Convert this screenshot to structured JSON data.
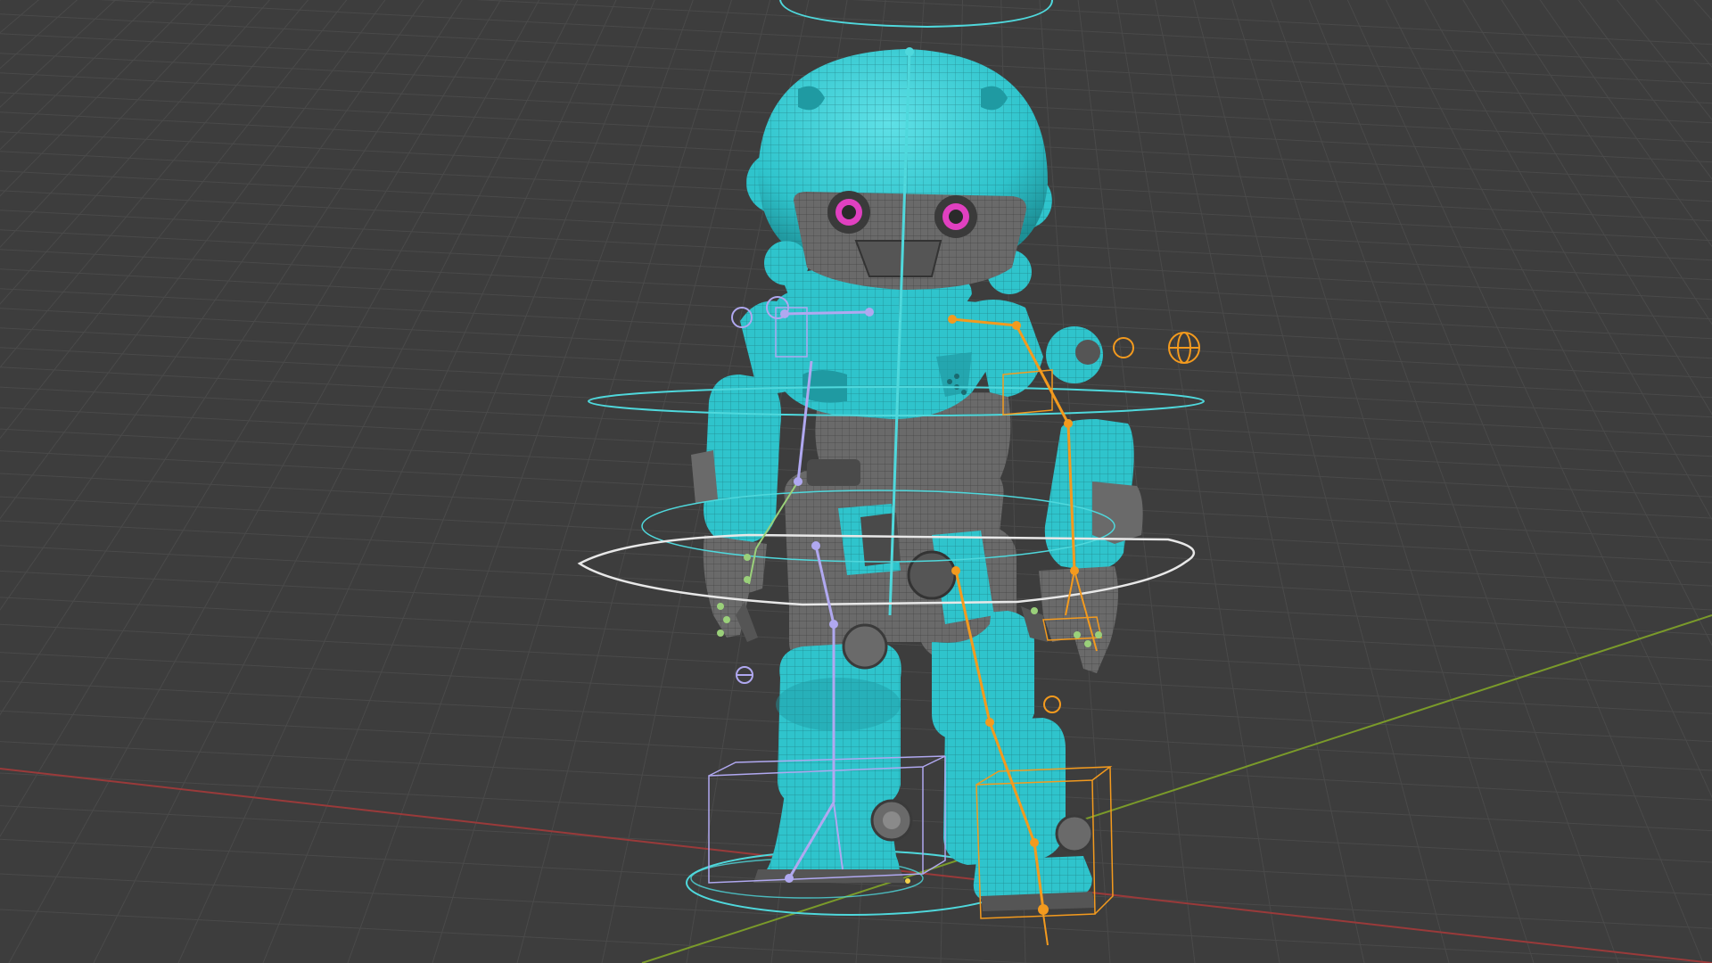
{
  "viewport": {
    "background": "#3d3d3d",
    "grid_color": "#4a4a4a",
    "x_axis_color": "#9a3a3a",
    "y_axis_color": "#7a9a2a"
  },
  "character": {
    "mesh_color": "#2fc4cc",
    "mesh_shade": "#1f9aa2",
    "mechanical_color": "#6a6a6a",
    "mechanical_dark": "#444444",
    "wire_color": "#14555a",
    "eye_color": "#e040c0"
  },
  "rig": {
    "control_color": "#4fd8dc",
    "selected_control_color": "#e8e8e8",
    "left_bone_color": "#b0a8f0",
    "right_bone_color": "#f39a1e",
    "spine_bone_color": "#4fd8dc"
  }
}
